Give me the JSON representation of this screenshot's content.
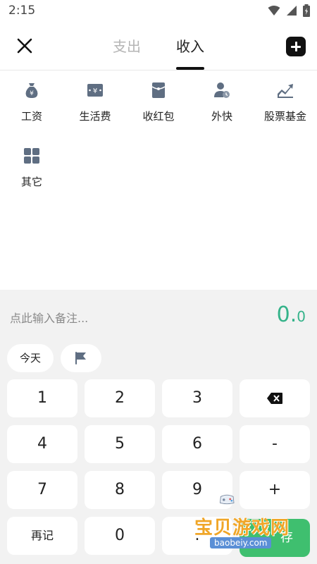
{
  "status_bar": {
    "time": "2:15"
  },
  "header": {
    "tabs": [
      {
        "label": "支出",
        "active": false
      },
      {
        "label": "收入",
        "active": true
      }
    ]
  },
  "categories": [
    {
      "label": "工资",
      "icon": "money-bag-icon"
    },
    {
      "label": "生活费",
      "icon": "yuan-card-icon"
    },
    {
      "label": "收红包",
      "icon": "red-envelope-icon"
    },
    {
      "label": "外快",
      "icon": "person-clock-icon"
    },
    {
      "label": "股票基金",
      "icon": "trend-chart-icon"
    },
    {
      "label": "其它",
      "icon": "grid-icon"
    }
  ],
  "note": {
    "placeholder": "点此输入备注..."
  },
  "amount": {
    "integer": "0.",
    "decimal": "0"
  },
  "date_chip": {
    "label": "今天"
  },
  "keypad": {
    "rows": [
      [
        "1",
        "2",
        "3",
        "⌫"
      ],
      [
        "4",
        "5",
        "6",
        "-"
      ],
      [
        "7",
        "8",
        "9",
        "+"
      ],
      [
        "再记",
        "0",
        ".",
        "保存"
      ]
    ],
    "save_label": "存"
  },
  "watermark": {
    "text": "宝贝游戏网",
    "url": "baobeiy.com"
  },
  "colors": {
    "accent": "#35b38a",
    "panel_bg": "#f2f2f2",
    "icon": "#5f6e82"
  }
}
